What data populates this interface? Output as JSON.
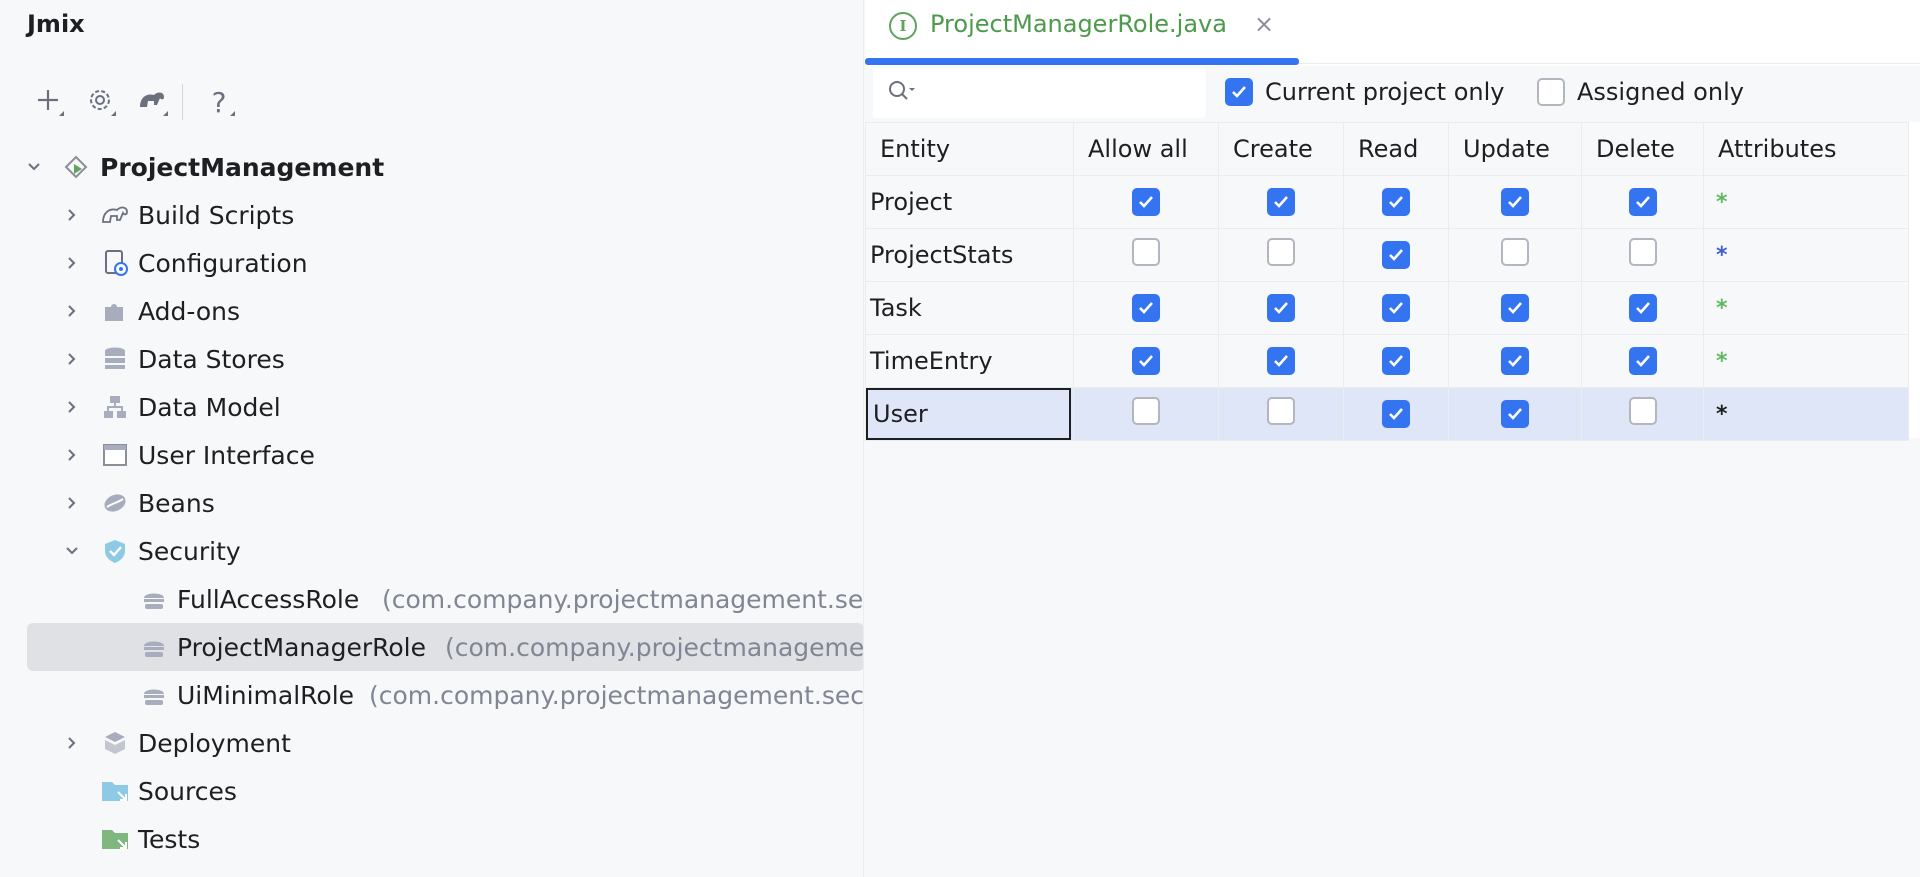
{
  "left_panel": {
    "title": "Jmix",
    "toolbar": [
      "add-icon",
      "gear-icon",
      "gradle-icon",
      "help-icon"
    ],
    "tree": [
      {
        "label": "ProjectManagement",
        "level": 0,
        "expanded": true,
        "bold": true,
        "icon": "project-icon"
      },
      {
        "label": "Build Scripts",
        "level": 1,
        "expanded": false,
        "icon": "gradle-icon"
      },
      {
        "label": "Configuration",
        "level": 1,
        "expanded": false,
        "icon": "config-icon"
      },
      {
        "label": "Add-ons",
        "level": 1,
        "expanded": false,
        "icon": "puzzle-icon"
      },
      {
        "label": "Data Stores",
        "level": 1,
        "expanded": false,
        "icon": "database-icon"
      },
      {
        "label": "Data Model",
        "level": 1,
        "expanded": false,
        "icon": "data-model-icon"
      },
      {
        "label": "User Interface",
        "level": 1,
        "expanded": false,
        "icon": "window-icon"
      },
      {
        "label": "Beans",
        "level": 1,
        "expanded": false,
        "icon": "bean-icon"
      },
      {
        "label": "Security",
        "level": 1,
        "expanded": true,
        "icon": "shield-icon"
      },
      {
        "label": "FullAccessRole",
        "level": 2,
        "package": "(com.company.projectmanagement.sec",
        "icon": "role-icon"
      },
      {
        "label": "ProjectManagerRole",
        "level": 2,
        "package": "(com.company.projectmanagemen",
        "icon": "role-icon",
        "selected": true
      },
      {
        "label": "UiMinimalRole",
        "level": 2,
        "package": "(com.company.projectmanagement.secu",
        "icon": "role-icon"
      },
      {
        "label": "Deployment",
        "level": 1,
        "expanded": false,
        "icon": "deployment-icon"
      },
      {
        "label": "Sources",
        "level": 1,
        "icon": "folder-sources-icon"
      },
      {
        "label": "Tests",
        "level": 1,
        "icon": "folder-tests-icon"
      }
    ]
  },
  "editor": {
    "tab": {
      "label": "ProjectManagerRole.java",
      "icon": "interface-icon",
      "close": "×"
    },
    "search": {
      "placeholder": ""
    },
    "filters": {
      "current_project_only": {
        "label": "Current project only",
        "checked": true
      },
      "assigned_only": {
        "label": "Assigned only",
        "checked": false
      }
    },
    "columns": [
      "Entity",
      "Allow all",
      "Create",
      "Read",
      "Update",
      "Delete",
      "Attributes"
    ],
    "rows": [
      {
        "entity": "Project",
        "allow_all": true,
        "create": true,
        "read": true,
        "update": true,
        "delete": true,
        "attributes": "*",
        "attr_color": "#5fb85f"
      },
      {
        "entity": "ProjectStats",
        "allow_all": false,
        "create": false,
        "read": true,
        "update": false,
        "delete": false,
        "attributes": "*",
        "attr_color": "#3f5fcf"
      },
      {
        "entity": "Task",
        "allow_all": true,
        "create": true,
        "read": true,
        "update": true,
        "delete": true,
        "attributes": "*",
        "attr_color": "#5fb85f"
      },
      {
        "entity": "TimeEntry",
        "allow_all": true,
        "create": true,
        "read": true,
        "update": true,
        "delete": true,
        "attributes": "*",
        "attr_color": "#5fb85f"
      },
      {
        "entity": "User",
        "allow_all": false,
        "create": false,
        "read": true,
        "update": true,
        "delete": false,
        "attributes": "*",
        "attr_color": "#1e1f22",
        "selected": true
      }
    ]
  },
  "colors": {
    "accent": "#3574f0",
    "tab_text": "#4d9a4d",
    "selection_row": "#dfe6f7",
    "tree_selection": "#dfe1e5"
  }
}
